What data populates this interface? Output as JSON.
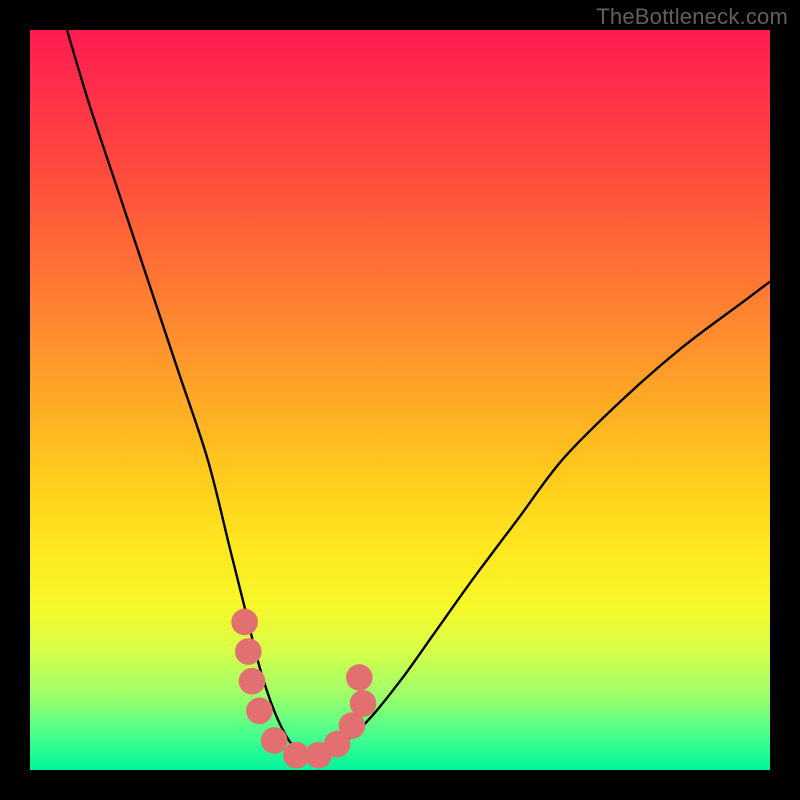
{
  "watermark": {
    "text": "TheBottleneck.com"
  },
  "chart_data": {
    "type": "line",
    "title": "",
    "xlabel": "",
    "ylabel": "",
    "xlim": [
      0,
      100
    ],
    "ylim": [
      0,
      100
    ],
    "grid": false,
    "legend": false,
    "x": [
      5,
      8,
      12,
      16,
      20,
      24,
      27,
      29,
      31,
      33,
      35,
      37,
      40,
      45,
      50,
      55,
      60,
      66,
      72,
      80,
      88,
      96,
      100
    ],
    "values": [
      100,
      90,
      78,
      66,
      54,
      42,
      30,
      22,
      14,
      8,
      4,
      2,
      2,
      6,
      12,
      19,
      26,
      34,
      42,
      50,
      57,
      63,
      66
    ],
    "gradient_stops": [
      {
        "offset": 0.0,
        "color": "#ff1c52"
      },
      {
        "offset": 0.2,
        "color": "#ff4d3c"
      },
      {
        "offset": 0.42,
        "color": "#ff8f2e"
      },
      {
        "offset": 0.58,
        "color": "#ffc41e"
      },
      {
        "offset": 0.7,
        "color": "#ffe81e"
      },
      {
        "offset": 0.78,
        "color": "#f6f82a"
      },
      {
        "offset": 0.84,
        "color": "#d6ff4a"
      },
      {
        "offset": 0.9,
        "color": "#9cff6a"
      },
      {
        "offset": 0.95,
        "color": "#4cff8c"
      },
      {
        "offset": 1.0,
        "color": "#00f59c"
      }
    ],
    "markers": [
      {
        "x": 29.0,
        "y": 20.0
      },
      {
        "x": 29.5,
        "y": 16.0
      },
      {
        "x": 30.0,
        "y": 12.0
      },
      {
        "x": 31.0,
        "y": 8.0
      },
      {
        "x": 33.0,
        "y": 4.0
      },
      {
        "x": 36.0,
        "y": 2.0
      },
      {
        "x": 39.0,
        "y": 2.0
      },
      {
        "x": 41.5,
        "y": 3.5
      },
      {
        "x": 43.5,
        "y": 6.0
      },
      {
        "x": 45.0,
        "y": 9.0
      },
      {
        "x": 44.5,
        "y": 12.5
      }
    ],
    "curve_color": "#000000",
    "marker_color": "#e27070",
    "marker_radius_pct": 1.8
  }
}
